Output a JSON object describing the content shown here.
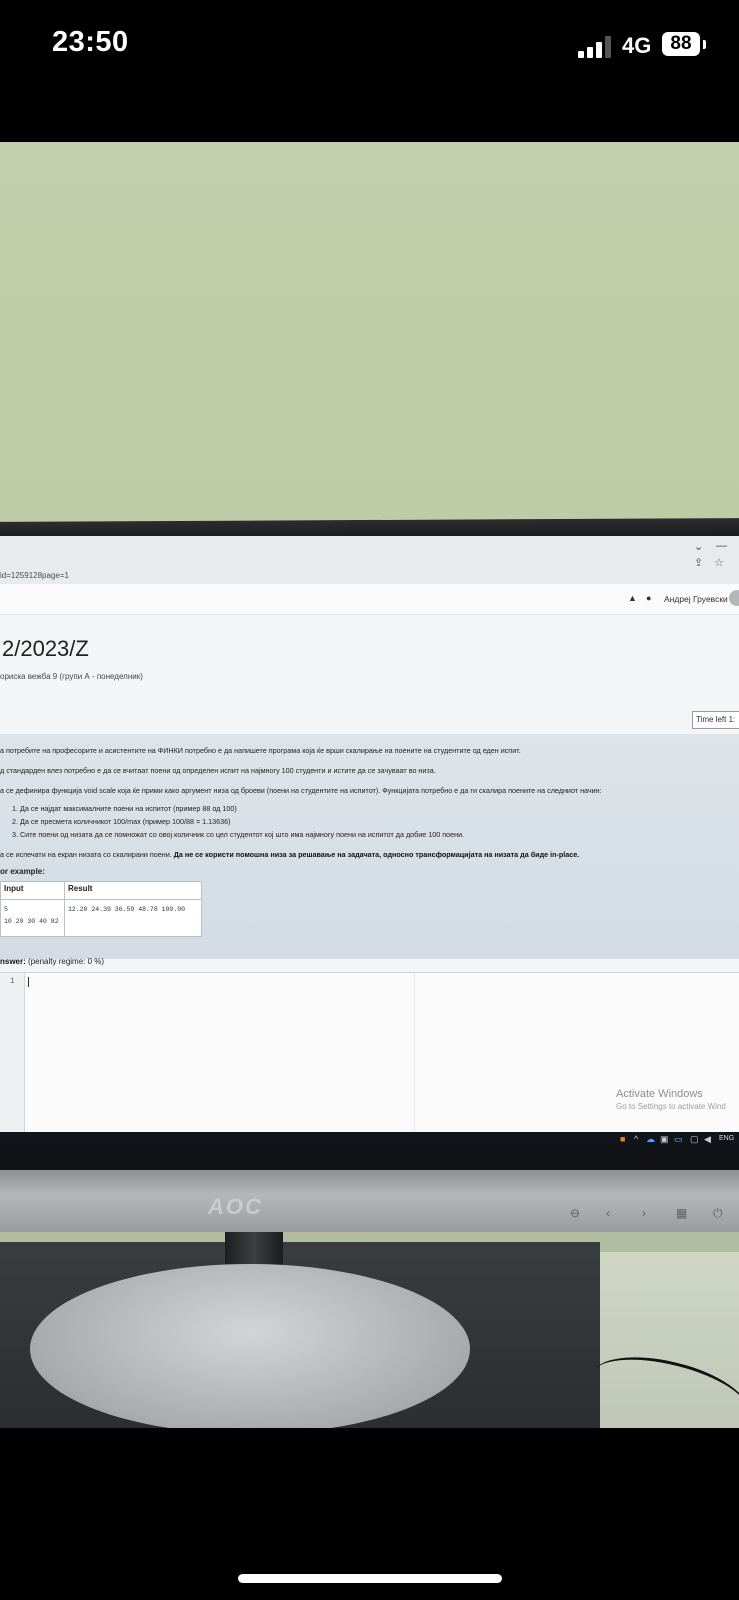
{
  "status_bar": {
    "time": "23:50",
    "network": "4G",
    "battery": "88"
  },
  "browser": {
    "url": "id=1259128page=1",
    "user_name": "Андреј Груевски",
    "course_title": "2/2023/Z",
    "breadcrumb": "ориска вежба 9 (групи А - понеделник)",
    "time_left": "Time left 1:",
    "question": {
      "para1": "а потребите на професорите и асистентите на ФИНКИ потребно е да напишете програма која ќе врши скалирање на поените на студентите од еден испит.",
      "para2": "д стандарден влез потребно е да се вчитаат поени од определен испит на најмногу 100 студенти и истите да се зачуваат во низа.",
      "para3": "а се дефинира функција void scale која ќе прими како аргумент низа од броеви (поени на студентите на испитот). Функцијата потребно е да ги скалира поените на следниот начин:",
      "step1": "1. Да се најдат максималните поени на испитот (пример 88 од 100)",
      "step2": "2. Да се пресмета количникот 100/max (пример 100/88 = 1.13636)",
      "step3": "3. Сите поени од низата да се помножат со овој количник со цел студентот кој што има најмногу поени на испитот да добие 100 поени.",
      "para4": "а се испечати на екран низата со скалирани поени.",
      "para4_bold": "Да не се користи помошна низа за решавање на задачата, односно трансформацијата на низата да биде  in-place.",
      "for_example": "or example:",
      "col_input": "Input",
      "col_result": "Result",
      "input_line1": "5",
      "input_line2": "10 20 30 40 82",
      "result_line1": "12.20 24.39 36.59 48.78 100.00",
      "answer_label": "nswer:",
      "penalty": "(penalty regime: 0 %)"
    },
    "editor_line_number": "1",
    "activate_title": "Activate Windows",
    "activate_sub": "Go to Settings to activate Wind",
    "tray_lang": "ENG"
  },
  "monitor_brand": "AOC"
}
